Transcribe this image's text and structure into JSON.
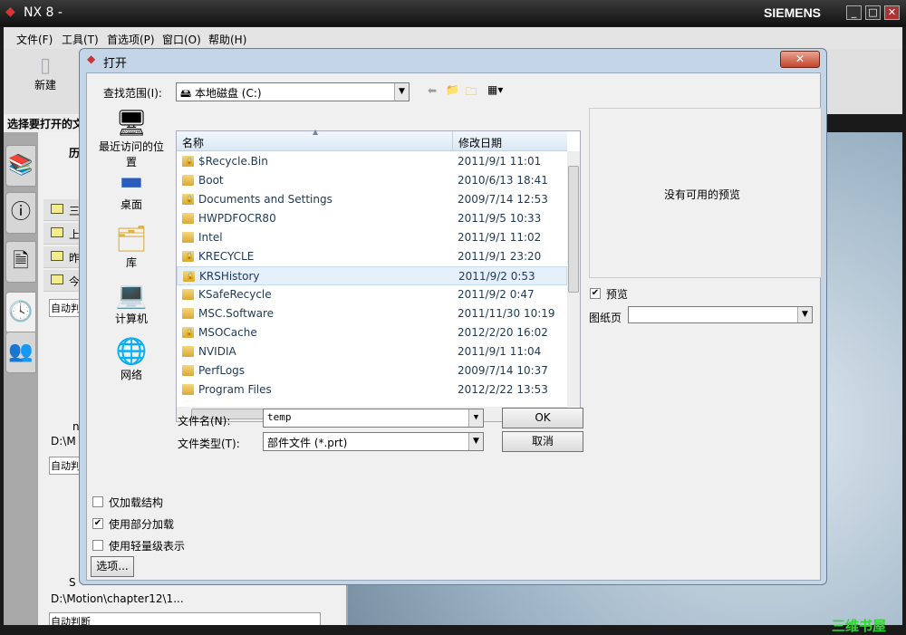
{
  "app": {
    "title": "NX 8 -",
    "brand": "SIEMENS",
    "menu": [
      "文件(F)",
      "工具(T)",
      "首选项(P)",
      "窗口(O)",
      "帮助(H)"
    ],
    "toolbar_new": "新建",
    "select_label": "选择要打开的文件",
    "panel": {
      "history": "历",
      "folders": [
        "三",
        "上",
        "昨",
        "今"
      ],
      "auto1": "自动判",
      "auto2": "自动判",
      "name_frag": "n",
      "path1": "D:\\M",
      "s_frag": "S",
      "path2": "D:\\Motion\\chapter12\\1...",
      "auto3": "自动判断"
    }
  },
  "dialog": {
    "title": "打开",
    "look_in_label": "查找范围(I):",
    "look_in_value": "本地磁盘 (C:)",
    "places": [
      "最近访问的位置",
      "桌面",
      "库",
      "计算机",
      "网络"
    ],
    "columns": {
      "name": "名称",
      "date": "修改日期"
    },
    "files": [
      {
        "name": "$Recycle.Bin",
        "date": "2011/9/1 11:01",
        "locked": true
      },
      {
        "name": "Boot",
        "date": "2010/6/13 18:41",
        "locked": false
      },
      {
        "name": "Documents and Settings",
        "date": "2009/7/14 12:53",
        "locked": true
      },
      {
        "name": "HWPDFOCR80",
        "date": "2011/9/5 10:33",
        "locked": false
      },
      {
        "name": "Intel",
        "date": "2011/9/1 11:02",
        "locked": false
      },
      {
        "name": "KRECYCLE",
        "date": "2011/9/1 23:20",
        "locked": true
      },
      {
        "name": "KRSHistory",
        "date": "2011/9/2 0:53",
        "locked": true,
        "hover": true
      },
      {
        "name": "KSafeRecycle",
        "date": "2011/9/2 0:47",
        "locked": false
      },
      {
        "name": "MSC.Software",
        "date": "2011/11/30 10:19",
        "locked": false
      },
      {
        "name": "MSOCache",
        "date": "2012/2/20 16:02",
        "locked": true
      },
      {
        "name": "NVIDIA",
        "date": "2011/9/1 11:04",
        "locked": false
      },
      {
        "name": "PerfLogs",
        "date": "2009/7/14 10:37",
        "locked": false
      },
      {
        "name": "Program Files",
        "date": "2012/2/22 13:53",
        "locked": false
      }
    ],
    "preview_text": "没有可用的预览",
    "preview_check": "预览",
    "preview_checked": true,
    "drawing_label": "图纸页",
    "filename_label": "文件名(N):",
    "filename_value": "temp",
    "filetype_label": "文件类型(T):",
    "filetype_value": "部件文件 (*.prt)",
    "ok": "OK",
    "cancel": "取消",
    "options": [
      {
        "label": "仅加载结构",
        "checked": false
      },
      {
        "label": "使用部分加载",
        "checked": true
      },
      {
        "label": "使用轻量级表示",
        "checked": false
      }
    ],
    "options_button": "选项..."
  },
  "watermark": "三维书屋"
}
